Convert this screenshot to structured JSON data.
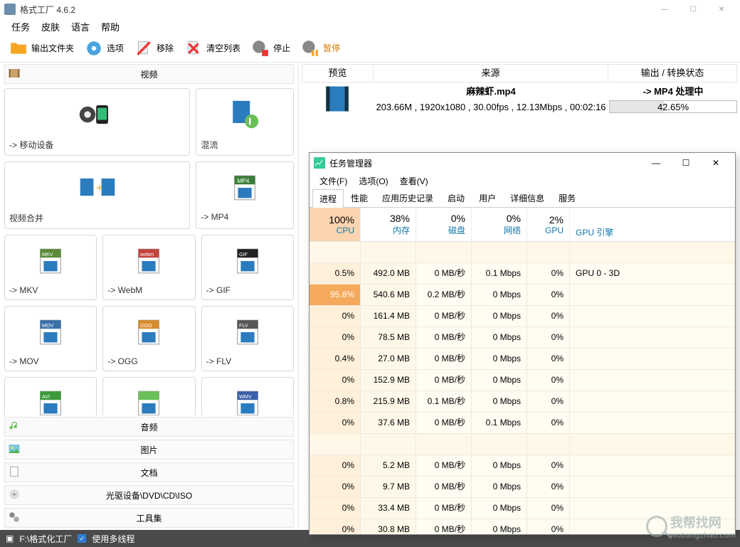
{
  "app": {
    "title": "格式工厂 4.6.2"
  },
  "menubar": [
    "任务",
    "皮肤",
    "语言",
    "帮助"
  ],
  "toolbar": {
    "out_folder": "输出文件夹",
    "options": "选项",
    "remove": "移除",
    "clear": "清空列表",
    "stop": "停止",
    "pause": "暂停"
  },
  "categories": {
    "video": "视频",
    "audio": "音频",
    "image": "图片",
    "doc": "文档",
    "disc": "光驱设备\\DVD\\CD\\ISO",
    "tools": "工具集"
  },
  "formats": [
    {
      "label": "-> 移动设备",
      "w": 2
    },
    {
      "label": "混流",
      "w": 1
    },
    {
      "label": "视频合并",
      "w": 2
    },
    {
      "label": "-> MP4",
      "w": 1
    },
    {
      "label": "-> MKV",
      "w": 1
    },
    {
      "label": "-> WebM",
      "w": 1
    },
    {
      "label": "-> GIF",
      "w": 1
    },
    {
      "label": "-> MOV",
      "w": 1
    },
    {
      "label": "-> OGG",
      "w": 1
    },
    {
      "label": "-> FLV",
      "w": 1
    },
    {
      "label": "-> AVI",
      "w": 1
    },
    {
      "label": "",
      "w": 1
    },
    {
      "label": "-> WMV",
      "w": 1
    }
  ],
  "rt_head": {
    "preview": "预览",
    "source": "来源",
    "status": "输出 / 转换状态"
  },
  "task": {
    "filename": "麻辣虾.mp4",
    "info": "203.66M , 1920x1080 , 30.00fps , 12.13Mbps , 00:02:16",
    "status_label": "-> MP4 处理中",
    "progress_pct": "42.65%",
    "progress_val": 42.65
  },
  "taskman": {
    "title": "任务管理器",
    "menu": [
      "文件(F)",
      "选项(O)",
      "查看(V)"
    ],
    "tabs": [
      "进程",
      "性能",
      "应用历史记录",
      "启动",
      "用户",
      "详细信息",
      "服务"
    ],
    "active_tab": 0,
    "headers": [
      {
        "pct": "100%",
        "label": "CPU",
        "class": "cpu"
      },
      {
        "pct": "38%",
        "label": "内存",
        "class": ""
      },
      {
        "pct": "0%",
        "label": "磁盘",
        "class": ""
      },
      {
        "pct": "0%",
        "label": "网络",
        "class": ""
      },
      {
        "pct": "2%",
        "label": "GPU",
        "class": ""
      }
    ],
    "gpu_engine": "GPU 引擎",
    "rows": [
      {
        "blank": true
      },
      {
        "cpu": "0.5%",
        "mem": "492.0 MB",
        "disk": "0 MB/秒",
        "net": "0.1 Mbps",
        "gpu": "0%",
        "eng": "GPU 0 - 3D"
      },
      {
        "cpu": "95.8%",
        "mem": "540.6 MB",
        "disk": "0.2 MB/秒",
        "net": "0 Mbps",
        "gpu": "0%",
        "eng": "",
        "hi": true
      },
      {
        "cpu": "0%",
        "mem": "161.4 MB",
        "disk": "0 MB/秒",
        "net": "0 Mbps",
        "gpu": "0%",
        "eng": ""
      },
      {
        "cpu": "0%",
        "mem": "78.5 MB",
        "disk": "0 MB/秒",
        "net": "0 Mbps",
        "gpu": "0%",
        "eng": ""
      },
      {
        "cpu": "0.4%",
        "mem": "27.0 MB",
        "disk": "0 MB/秒",
        "net": "0 Mbps",
        "gpu": "0%",
        "eng": ""
      },
      {
        "cpu": "0%",
        "mem": "152.9 MB",
        "disk": "0 MB/秒",
        "net": "0 Mbps",
        "gpu": "0%",
        "eng": ""
      },
      {
        "cpu": "0.8%",
        "mem": "215.9 MB",
        "disk": "0.1 MB/秒",
        "net": "0 Mbps",
        "gpu": "0%",
        "eng": ""
      },
      {
        "cpu": "0%",
        "mem": "37.6 MB",
        "disk": "0 MB/秒",
        "net": "0.1 Mbps",
        "gpu": "0%",
        "eng": ""
      },
      {
        "blank": true
      },
      {
        "cpu": "0%",
        "mem": "5.2 MB",
        "disk": "0 MB/秒",
        "net": "0 Mbps",
        "gpu": "0%",
        "eng": ""
      },
      {
        "cpu": "0%",
        "mem": "9.7 MB",
        "disk": "0 MB/秒",
        "net": "0 Mbps",
        "gpu": "0%",
        "eng": ""
      },
      {
        "cpu": "0%",
        "mem": "33.4 MB",
        "disk": "0 MB/秒",
        "net": "0 Mbps",
        "gpu": "0%",
        "eng": ""
      },
      {
        "cpu": "0%",
        "mem": "30.8 MB",
        "disk": "0 MB/秒",
        "net": "0 Mbps",
        "gpu": "0%",
        "eng": ""
      }
    ]
  },
  "statusbar": {
    "path": "F:\\格式化工厂",
    "multithread": "使用多线程"
  },
  "watermark": {
    "text": "我帮找网",
    "url": "wobangzhao.com"
  }
}
